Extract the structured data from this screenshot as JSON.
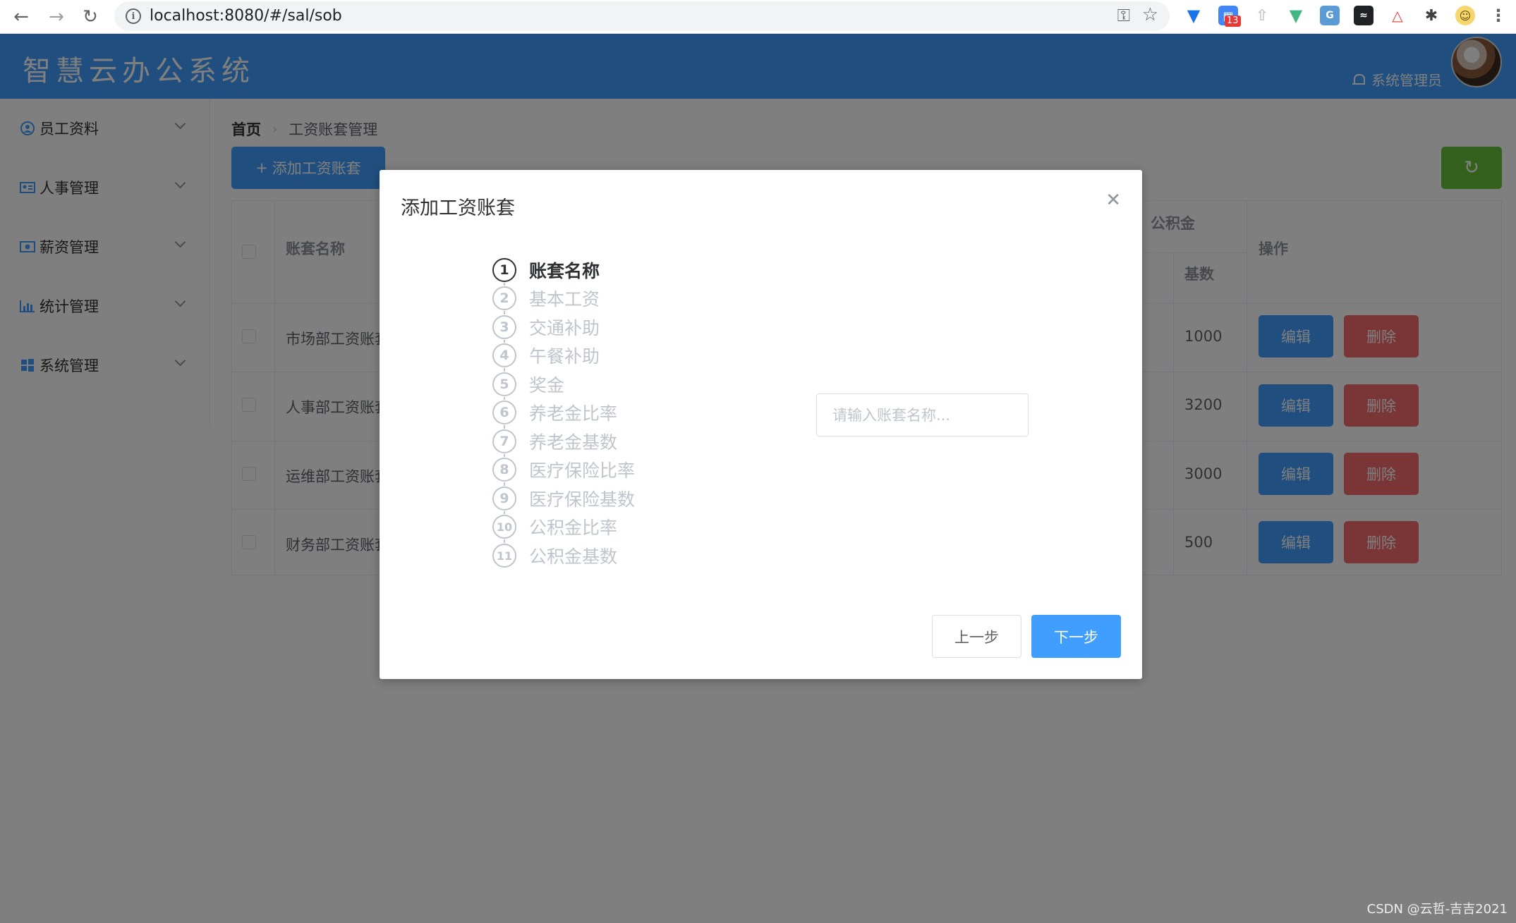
{
  "browser": {
    "url": "localhost:8080/#/sal/sob",
    "extension_badge": "13"
  },
  "header": {
    "logo": "智慧云办公系统",
    "user_name": "系统管理员"
  },
  "sidebar": {
    "items": [
      {
        "label": "员工资料",
        "icon": "user-circle-icon"
      },
      {
        "label": "人事管理",
        "icon": "id-card-icon"
      },
      {
        "label": "薪资管理",
        "icon": "money-icon"
      },
      {
        "label": "统计管理",
        "icon": "bar-chart-icon"
      },
      {
        "label": "系统管理",
        "icon": "windows-icon"
      }
    ]
  },
  "breadcrumb": {
    "home": "首页",
    "current": "工资账套管理"
  },
  "toolbar": {
    "add_label": "添加工资账套"
  },
  "table": {
    "headers": {
      "name": "账套名称",
      "housing_fund": "公积金",
      "base": "基数",
      "actions": "操作"
    },
    "rows": [
      {
        "name": "市场部工资账套",
        "base": "1000"
      },
      {
        "name": "人事部工资账套",
        "base": "3200"
      },
      {
        "name": "运维部工资账套",
        "base": "3000"
      },
      {
        "name": "财务部工资账套",
        "base": "500"
      }
    ],
    "edit_label": "编辑",
    "delete_label": "删除"
  },
  "dialog": {
    "title": "添加工资账套",
    "steps": [
      "账套名称",
      "基本工资",
      "交通补助",
      "午餐补助",
      "奖金",
      "养老金比率",
      "养老金基数",
      "医疗保险比率",
      "医疗保险基数",
      "公积金比率",
      "公积金基数"
    ],
    "active_step": 1,
    "input_placeholder": "请输入账套名称...",
    "input_value": "",
    "prev_label": "上一步",
    "next_label": "下一步"
  },
  "colors": {
    "primary": "#409eff",
    "success": "#67c23a",
    "danger": "#f56c6c"
  },
  "watermark": "CSDN @云哲-吉吉2021"
}
